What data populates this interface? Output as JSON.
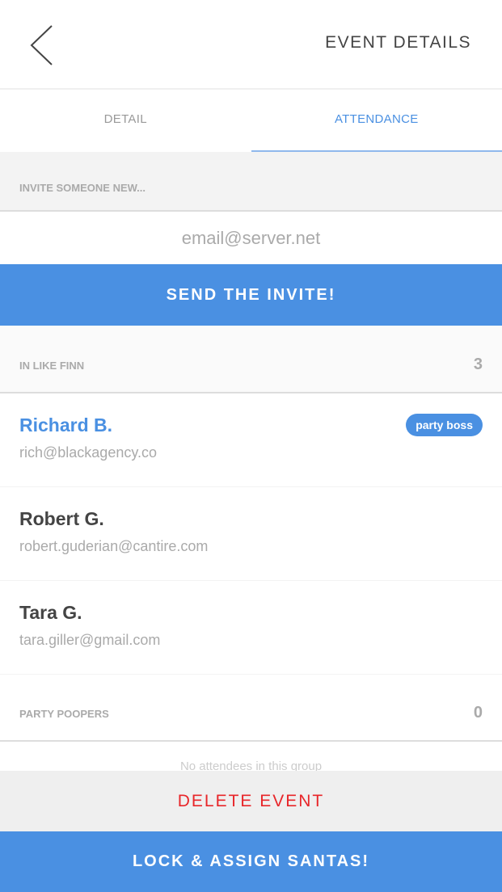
{
  "header": {
    "title": "EVENT DETAILS",
    "back_icon": "chevron-left-icon"
  },
  "tabs": [
    {
      "label": "DETAIL",
      "active": false
    },
    {
      "label": "ATTENDANCE",
      "active": true
    }
  ],
  "invite": {
    "label": "INVITE SOMEONE NEW...",
    "placeholder": "email@server.net",
    "button": "SEND THE INVITE!"
  },
  "groups": [
    {
      "label": "IN LIKE FINN",
      "count": "3",
      "members": [
        {
          "name": "Richard B.",
          "email": "rich@blackagency.co",
          "badge": "party boss"
        },
        {
          "name": "Robert G.",
          "email": "robert.guderian@cantire.com"
        },
        {
          "name": "Tara G.",
          "email": "tara.giller@gmail.com"
        }
      ]
    },
    {
      "label": "PARTY POOPERS",
      "count": "0",
      "empty_text": "No attendees in this group"
    }
  ],
  "footer": {
    "delete": "DELETE EVENT",
    "lock": "LOCK & ASSIGN SANTAS!"
  },
  "colors": {
    "accent": "#4a90e2",
    "danger": "#e8262a"
  }
}
